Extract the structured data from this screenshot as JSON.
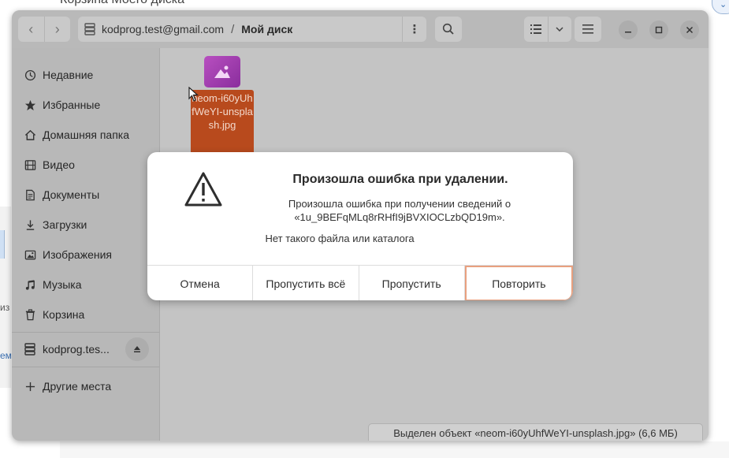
{
  "background": {
    "title": "Корзина Моего диска",
    "left_fragment_1": "из",
    "left_fragment_2": "ем"
  },
  "header": {
    "account": "kodprog.test@gmail.com",
    "separator": "/",
    "current_folder": "Мой диск"
  },
  "sidebar": {
    "items": [
      {
        "label": "Недавние",
        "icon": "clock-icon"
      },
      {
        "label": "Избранные",
        "icon": "star-icon"
      },
      {
        "label": "Домашняя папка",
        "icon": "home-icon"
      },
      {
        "label": "Видео",
        "icon": "film-icon"
      },
      {
        "label": "Документы",
        "icon": "document-icon"
      },
      {
        "label": "Загрузки",
        "icon": "download-icon"
      },
      {
        "label": "Изображения",
        "icon": "image-icon"
      },
      {
        "label": "Музыка",
        "icon": "music-icon"
      },
      {
        "label": "Корзина",
        "icon": "trash-icon"
      }
    ],
    "drive": {
      "label": "kodprog.tes...",
      "icon": "drive-icon"
    },
    "other": {
      "label": "Другие места",
      "icon": "plus-icon"
    }
  },
  "content": {
    "file_name": "neom-i60yUhfWeYI-unsplash.jpg",
    "status": "Выделен объект «neom-i60yUhfWeYI-unsplash.jpg» (6,6 МБ)"
  },
  "dialog": {
    "title": "Произошла ошибка при удалении.",
    "message_line1": "Произошла ошибка при получении сведений о",
    "message_line2": "«1u_9BEFqMLq8rRHfI9jBVXIOCLzbQD19m».",
    "detail": "Нет такого файла или каталога",
    "buttons": {
      "cancel": "Отмена",
      "skip_all": "Пропустить всё",
      "skip": "Пропустить",
      "retry": "Повторить"
    }
  },
  "colors": {
    "selection": "#b84a1d",
    "focus_ring": "#e8a07f",
    "image_icon": "#a03eb2"
  }
}
